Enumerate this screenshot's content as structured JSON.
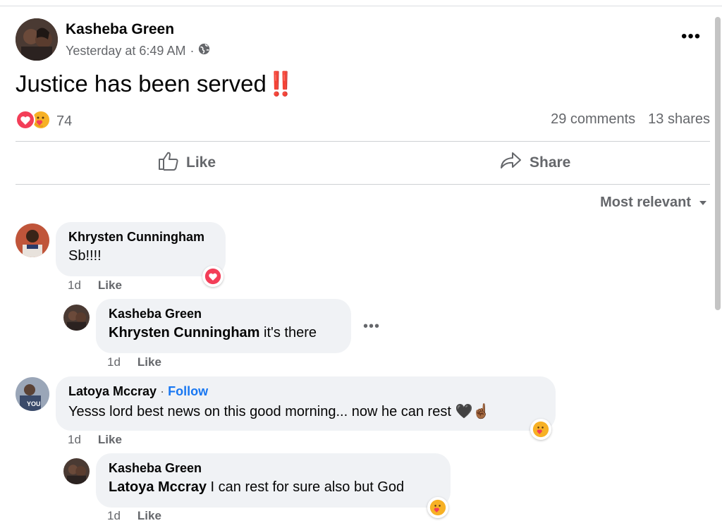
{
  "post": {
    "author": "Kasheba Green",
    "timestamp": "Yesterday at 6:49 AM",
    "meta_separator": "·",
    "privacy_icon": "globe-icon",
    "more_label": "•••",
    "text": "Justice has been served",
    "emoji": "‼️",
    "reaction_icons": [
      "love-reaction-icon",
      "care-reaction-icon"
    ],
    "reaction_count": "74",
    "comments_count": "29 comments",
    "shares_count": "13 shares"
  },
  "actions": {
    "like_label": "Like",
    "share_label": "Share"
  },
  "sort": {
    "label": "Most relevant",
    "icon": "caret-down-icon"
  },
  "comments": [
    {
      "name": "Khrysten Cunningham",
      "text": "Sb!!!!",
      "time": "1d",
      "like_label": "Like",
      "reaction": "love-reaction-icon"
    },
    {
      "name": "Kasheba Green",
      "mention": "Khrysten Cunningham",
      "text": "it's there",
      "time": "1d",
      "like_label": "Like",
      "more_label": "•••"
    },
    {
      "name": "Latoya Mccray",
      "follow_separator": "·",
      "follow_label": "Follow",
      "text": "Yesss lord best news on this good morning... now he can rest 🖤☝🏾",
      "time": "1d",
      "like_label": "Like",
      "reaction": "care-reaction-icon",
      "avatar_caption": "YOU"
    },
    {
      "name": "Kasheba Green",
      "mention": "Latoya Mccray",
      "text": "I can rest for sure also but God",
      "time": "1d",
      "like_label": "Like",
      "reaction": "care-reaction-icon"
    }
  ],
  "colors": {
    "link": "#1877f2",
    "secondary_text": "#65676b",
    "bubble": "#f0f2f5",
    "love": "#f33e58",
    "care": "#f7b125"
  }
}
